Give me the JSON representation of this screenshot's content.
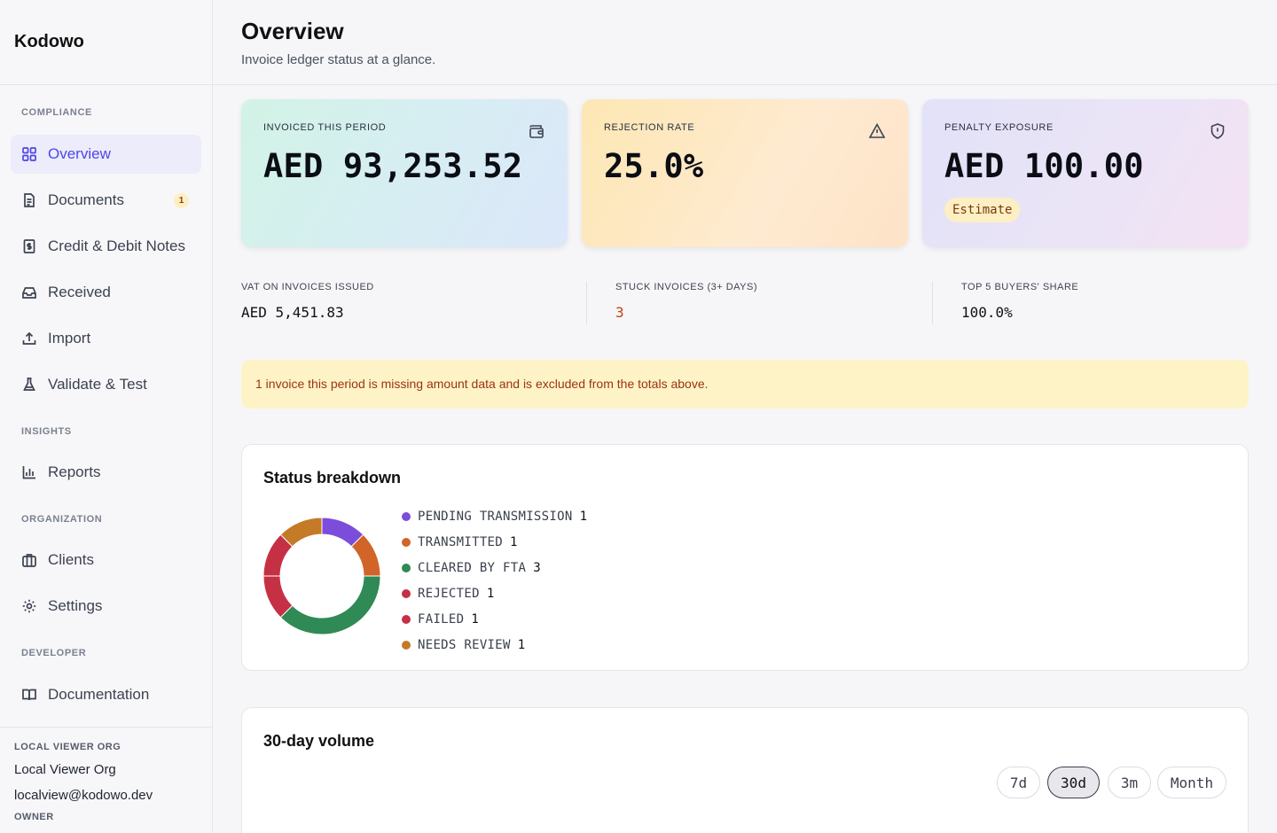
{
  "app": {
    "name": "Kodowo"
  },
  "sidebar": {
    "sections": {
      "compliance": "COMPLIANCE",
      "insights": "INSIGHTS",
      "organization": "ORGANIZATION",
      "developer": "DEVELOPER"
    },
    "items": {
      "overview": "Overview",
      "documents": "Documents",
      "documents_badge": "1",
      "notes": "Credit & Debit Notes",
      "received": "Received",
      "import": "Import",
      "validate": "Validate & Test",
      "reports": "Reports",
      "clients": "Clients",
      "settings": "Settings",
      "documentation": "Documentation"
    },
    "user": {
      "org_label": "LOCAL VIEWER ORG",
      "org_name": "Local Viewer Org",
      "email": "localview@kodowo.dev",
      "role": "OWNER"
    }
  },
  "header": {
    "title": "Overview",
    "subtitle": "Invoice ledger status at a glance."
  },
  "cards": [
    {
      "label": "INVOICED THIS PERIOD",
      "value": "AED 93,253.52",
      "icon": "wallet-icon"
    },
    {
      "label": "REJECTION RATE",
      "value": "25.0%",
      "icon": "warning-icon"
    },
    {
      "label": "PENALTY EXPOSURE",
      "value": "AED 100.00",
      "icon": "shield-icon",
      "tag": "Estimate"
    }
  ],
  "metrics": [
    {
      "label": "VAT ON INVOICES ISSUED",
      "value": "AED 5,451.83"
    },
    {
      "label": "STUCK INVOICES (3+ DAYS)",
      "value": "3"
    },
    {
      "label": "TOP 5 BUYERS' SHARE",
      "value": "100.0%"
    }
  ],
  "alert": {
    "text": "1 invoice this period is missing amount data and is excluded from the totals above."
  },
  "status_breakdown": {
    "title": "Status breakdown",
    "items": [
      {
        "name": "PENDING TRANSMISSION",
        "count": 1,
        "color": "#7c4ddb"
      },
      {
        "name": "TRANSMITTED",
        "count": 1,
        "color": "#d2642a"
      },
      {
        "name": "CLEARED BY FTA",
        "count": 3,
        "color": "#2f8a55"
      },
      {
        "name": "REJECTED",
        "count": 1,
        "color": "#c53045"
      },
      {
        "name": "FAILED",
        "count": 1,
        "color": "#c53045"
      },
      {
        "name": "NEEDS REVIEW",
        "count": 1,
        "color": "#c47a26"
      }
    ]
  },
  "volume": {
    "title": "30-day volume",
    "ranges": [
      "7d",
      "30d",
      "3m",
      "Month"
    ],
    "selected": "30d"
  }
}
